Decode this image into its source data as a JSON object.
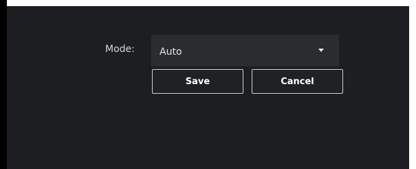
{
  "form": {
    "mode_label": "Mode:",
    "mode_value": "Auto",
    "save_label": "Save",
    "cancel_label": "Cancel"
  },
  "colors": {
    "panel_background": "#1c1e21",
    "select_background": "#2a2c2f",
    "button_border": "#d4d4d4",
    "text": "#e6e6e6"
  },
  "icons": {
    "dropdown": "chevron-down-icon"
  }
}
